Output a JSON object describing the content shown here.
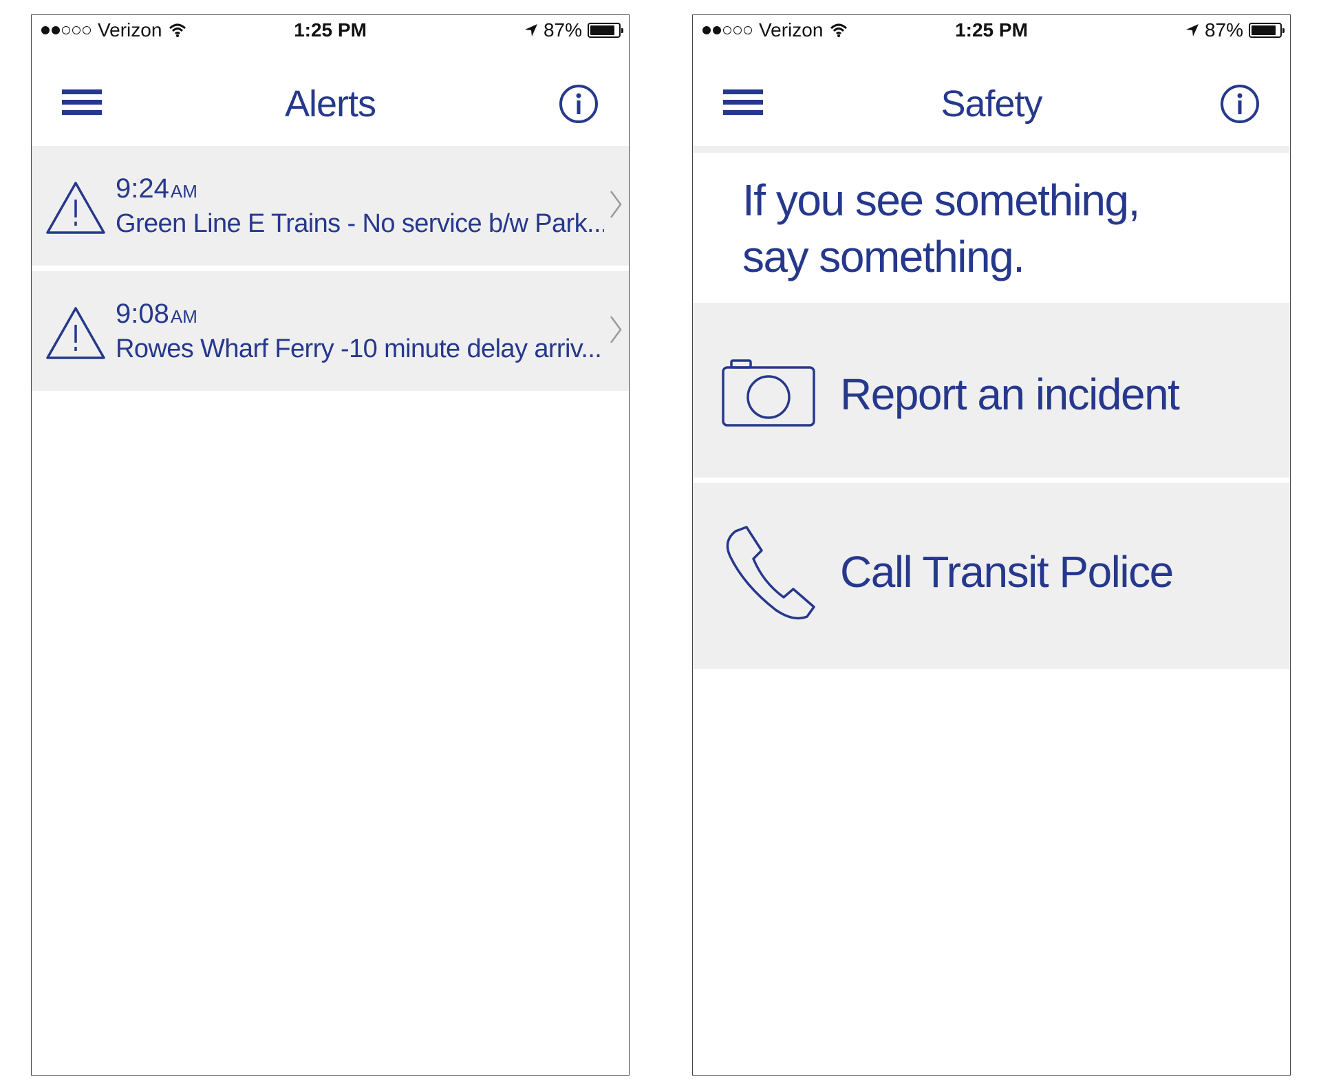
{
  "status_bar": {
    "carrier": "Verizon",
    "signal_dots_filled": 2,
    "signal_dots_total": 5,
    "time": "1:25 PM",
    "battery": "87%",
    "battery_fraction": 0.87
  },
  "alerts_screen": {
    "title": "Alerts",
    "alerts": [
      {
        "time": "9:24",
        "ampm": "AM",
        "text": "Green Line E Trains - No service b/w Park..."
      },
      {
        "time": "9:08",
        "ampm": "AM",
        "text": "Rowes Wharf Ferry -10 minute delay arriv..."
      }
    ]
  },
  "safety_screen": {
    "title": "Safety",
    "slogan_line1": "If you see something,",
    "slogan_line2": "say something.",
    "report_label": "Report an incident",
    "call_label": "Call Transit Police"
  },
  "icons": {
    "menu": "hamburger-menu-icon",
    "info": "info-icon",
    "warning": "warning-triangle-icon",
    "chevron": "chevron-right-icon",
    "camera": "camera-icon",
    "phone": "phone-handset-icon",
    "wifi": "wifi-icon",
    "location": "location-arrow-icon",
    "battery": "battery-icon"
  },
  "colors": {
    "accent": "#26388c",
    "row_background": "#efefef"
  }
}
